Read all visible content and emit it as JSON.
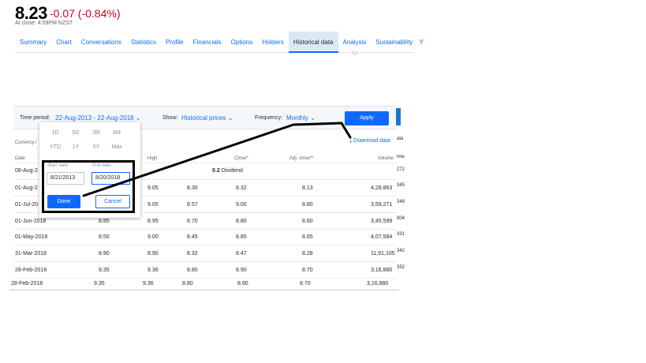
{
  "quote": {
    "price": "8.23",
    "change": "-0.07 (-0.84%)",
    "close_note": "At close: 4:59PM NZST"
  },
  "tabs": [
    {
      "label": "Summary"
    },
    {
      "label": "Chart"
    },
    {
      "label": "Conversations"
    },
    {
      "label": "Statistics"
    },
    {
      "label": "Profile"
    },
    {
      "label": "Financials"
    },
    {
      "label": "Options"
    },
    {
      "label": "Holders"
    },
    {
      "label": "Historical data"
    },
    {
      "label": "Analysis"
    },
    {
      "label": "Sustainability"
    }
  ],
  "tabs_more": "Y",
  "filters": {
    "time_period_label": "Time period:",
    "time_period_value": "22-Aug-2013 - 22-Aug-2018",
    "show_label": "Show:",
    "show_value": "Historical prices",
    "frequency_label": "Frequency:",
    "frequency_value": "Monthly",
    "apply": "Apply",
    "download": "Download data",
    "right_clip": "ata"
  },
  "currency_note": "Currency i",
  "table": {
    "headers": {
      "date": "Date",
      "high": "High",
      "close": "Close*",
      "adj_close": "Adj. close**",
      "volume": "Volume",
      "vol_clip": "ime"
    },
    "dividend": {
      "date": "08-Aug-2",
      "amount": "0.2",
      "label": "Dividend",
      "clip": "272"
    },
    "rows": [
      {
        "date": "01-Aug-2",
        "open": "",
        "high": "9.05",
        "low": "8.30",
        "close": "8.32",
        "adj": "8.13",
        "volume": "4,28,863",
        "clip": "345"
      },
      {
        "date": "01-Jul-20",
        "open": "",
        "high": "9.05",
        "low": "8.57",
        "close": "9.00",
        "adj": "8.80",
        "volume": "3,59,271",
        "clip": "348"
      },
      {
        "date": "01-Jun-2018",
        "open": "8.85",
        "high": "8.95",
        "low": "8.70",
        "close": "8.80",
        "adj": "8.60",
        "volume": "3,45,599",
        "clip": "904"
      },
      {
        "date": "01-May-2018",
        "open": "8.50",
        "high": "9.00",
        "low": "8.45",
        "close": "8.85",
        "adj": "8.65",
        "volume": "4,07,584",
        "clip": "331"
      },
      {
        "date": "31-Mar-2018",
        "open": "8.90",
        "high": "8.90",
        "low": "8.32",
        "close": "8.47",
        "adj": "8.28",
        "volume": "11,91,105",
        "clip": "342"
      },
      {
        "date": "28-Feb-2018",
        "open": "9.35",
        "high": "9.36",
        "low": "8.80",
        "close": "8.90",
        "adj": "8.70",
        "volume": "3,16,880",
        "clip": "352"
      }
    ],
    "extra_row": {
      "date": "28-Feb-2018",
      "open": "9.35",
      "high": "9.36",
      "low": "8.80",
      "close": "8.90",
      "adj": "8.70",
      "volume": "3,16,880"
    }
  },
  "period_dropdown": {
    "quick": [
      "1D",
      "5D",
      "3M",
      "6M",
      "YTD",
      "1Y",
      "5Y",
      "Max"
    ],
    "start_label": "Start date",
    "end_label": "End date",
    "start_value": "8/21/2013",
    "end_value": "8/20/2018",
    "done": "Done",
    "cancel": "Cancel"
  },
  "annotation_color": "#000000",
  "accent_color": "#0f69ff"
}
